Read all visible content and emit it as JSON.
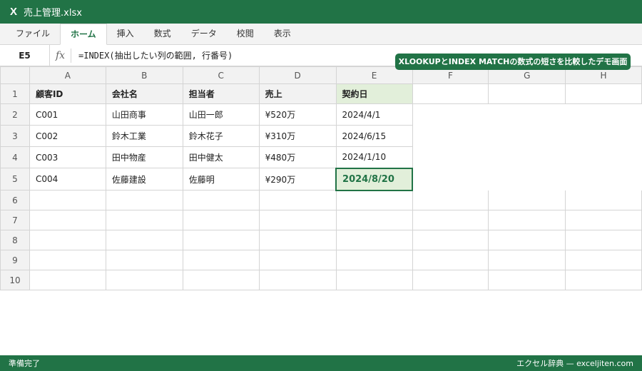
{
  "app": {
    "icon": "X",
    "title": "売上管理.xlsx"
  },
  "ribbon": {
    "tabs": [
      "ファイル",
      "ホーム",
      "挿入",
      "数式",
      "データ",
      "校閲",
      "表示"
    ],
    "active_index": 1
  },
  "formula_bar": {
    "cell_ref": "E5",
    "fx": "fx",
    "formula": "=INDEX(抽出したい列の範囲, 行番号)"
  },
  "banner": "XLOOKUPとINDEX MATCHの数式の短さを比較したデモ画面",
  "sheet": {
    "columns": [
      "A",
      "B",
      "C",
      "D",
      "E",
      "F",
      "G",
      "H"
    ],
    "rows": [
      [
        "顧客ID",
        "会社名",
        "担当者",
        "売上",
        "契約日",
        "",
        "",
        ""
      ],
      [
        "C001",
        "山田商事",
        "山田一郎",
        "¥520万",
        "2024/4/1",
        "",
        "",
        ""
      ],
      [
        "C002",
        "鈴木工業",
        "鈴木花子",
        "¥310万",
        "2024/6/15",
        "",
        "",
        ""
      ],
      [
        "C003",
        "田中物産",
        "田中健太",
        "¥480万",
        "2024/1/10",
        "",
        "",
        ""
      ],
      [
        "C004",
        "佐藤建設",
        "佐藤明",
        "¥290万",
        "2024/8/20",
        "",
        "",
        ""
      ],
      [
        "",
        "",
        "",
        "",
        "",
        "",
        "",
        ""
      ],
      [
        "",
        "",
        "",
        "",
        "",
        "",
        "",
        ""
      ],
      [
        "",
        "",
        "",
        "",
        "",
        "",
        "",
        ""
      ],
      [
        "",
        "",
        "",
        "",
        "",
        "",
        "",
        ""
      ],
      [
        "",
        "",
        "",
        "",
        "",
        "",
        "",
        ""
      ]
    ],
    "row_numbers": [
      "1",
      "2",
      "3",
      "4",
      "5",
      "6",
      "7",
      "8",
      "9",
      "10"
    ],
    "selected_cell": "E5"
  },
  "status": {
    "left": "準備完了",
    "right": "エクセル辞典 — exceljiten.com"
  },
  "colors": {
    "accent": "#217346",
    "highlight": "#e2efda"
  }
}
